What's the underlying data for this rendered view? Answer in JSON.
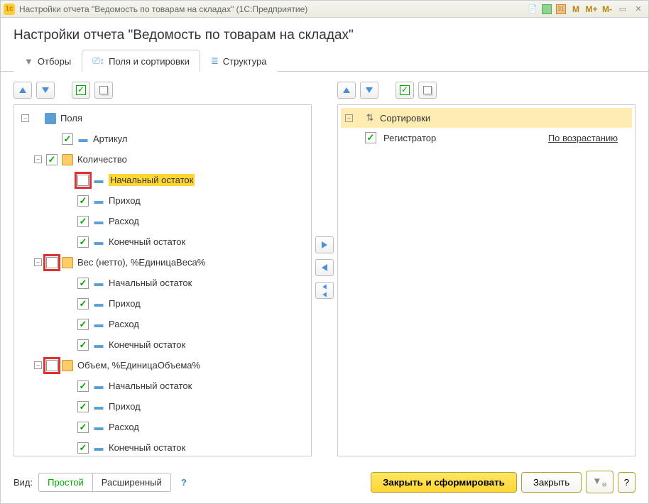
{
  "window": {
    "title": "Настройки отчета \"Ведомость по товарам на складах\"  (1С:Предприятие)"
  },
  "header": {
    "title": "Настройки отчета \"Ведомость по товарам на складах\""
  },
  "tabs": {
    "filters": "Отборы",
    "fields": "Поля и сортировки",
    "structure": "Структура"
  },
  "fields_tree": {
    "root": "Поля",
    "items": [
      {
        "label": "Артикул",
        "checked": true,
        "depth": 2,
        "type": "field"
      },
      {
        "label": "Количество",
        "checked": true,
        "depth": 1,
        "type": "folder",
        "expandable": true
      },
      {
        "label": "Начальный остаток",
        "checked": false,
        "depth": 3,
        "type": "field",
        "hl": true,
        "boxed": true
      },
      {
        "label": "Приход",
        "checked": true,
        "depth": 3,
        "type": "field"
      },
      {
        "label": "Расход",
        "checked": true,
        "depth": 3,
        "type": "field"
      },
      {
        "label": "Конечный остаток",
        "checked": true,
        "depth": 3,
        "type": "field"
      },
      {
        "label": "Вес (нетто), %ЕдиницаВеса%",
        "checked": false,
        "depth": 1,
        "type": "folder",
        "expandable": true,
        "boxed": true
      },
      {
        "label": "Начальный остаток",
        "checked": true,
        "depth": 3,
        "type": "field"
      },
      {
        "label": "Приход",
        "checked": true,
        "depth": 3,
        "type": "field"
      },
      {
        "label": "Расход",
        "checked": true,
        "depth": 3,
        "type": "field"
      },
      {
        "label": "Конечный остаток",
        "checked": true,
        "depth": 3,
        "type": "field"
      },
      {
        "label": "Объем, %ЕдиницаОбъема%",
        "checked": false,
        "depth": 1,
        "type": "folder",
        "expandable": true,
        "boxed": true
      },
      {
        "label": "Начальный остаток",
        "checked": true,
        "depth": 3,
        "type": "field"
      },
      {
        "label": "Приход",
        "checked": true,
        "depth": 3,
        "type": "field"
      },
      {
        "label": "Расход",
        "checked": true,
        "depth": 3,
        "type": "field"
      },
      {
        "label": "Конечный остаток",
        "checked": true,
        "depth": 3,
        "type": "field"
      }
    ]
  },
  "sort": {
    "header": "Сортировки",
    "items": [
      {
        "label": "Регистратор",
        "checked": true,
        "direction": "По возрастанию"
      }
    ]
  },
  "footer": {
    "view_label": "Вид:",
    "mode_simple": "Простой",
    "mode_advanced": "Расширенный",
    "close_and_form": "Закрыть и сформировать",
    "close": "Закрыть"
  }
}
